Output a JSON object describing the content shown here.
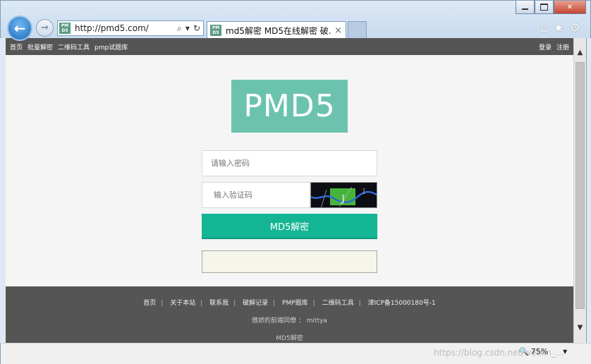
{
  "browser": {
    "url": "http://pmd5.com/",
    "tab_title": "md5解密 MD5在线解密 破...",
    "tab_close": "×",
    "back_glyph": "←",
    "forward_glyph": "→",
    "window_close": "✕",
    "favicon_text_top": "PM",
    "favicon_text_bottom": "D5",
    "tools": [
      "home-icon",
      "favorites-star-icon",
      "settings-gear-icon"
    ]
  },
  "topnav": {
    "left": [
      "首页",
      "批量解密",
      "二维码工具",
      "pmp试题库"
    ],
    "right": [
      "登录",
      "注册"
    ]
  },
  "main": {
    "logo_text": "PMD5",
    "password_placeholder": "请输入密码",
    "captcha_placeholder": "输入验证码",
    "submit_label": "MD5解密",
    "result_text": ""
  },
  "footer": {
    "links": [
      "首页",
      "关于本站",
      "联系我",
      "破解记录",
      "PMP题库",
      "二维码工具",
      "津ICP备15000180号-1"
    ],
    "credit": "傲娇的前端同僚 ： mittya",
    "brand": "MD5解密"
  },
  "statusbar": {
    "watermark": "https://blog.csdn.net/weixin_...",
    "zoom": "75%"
  },
  "colors": {
    "accent": "#14b594",
    "logo_bg": "#6bc3ae",
    "nav_bg": "#555555",
    "page_bg": "#f5f5f5"
  }
}
